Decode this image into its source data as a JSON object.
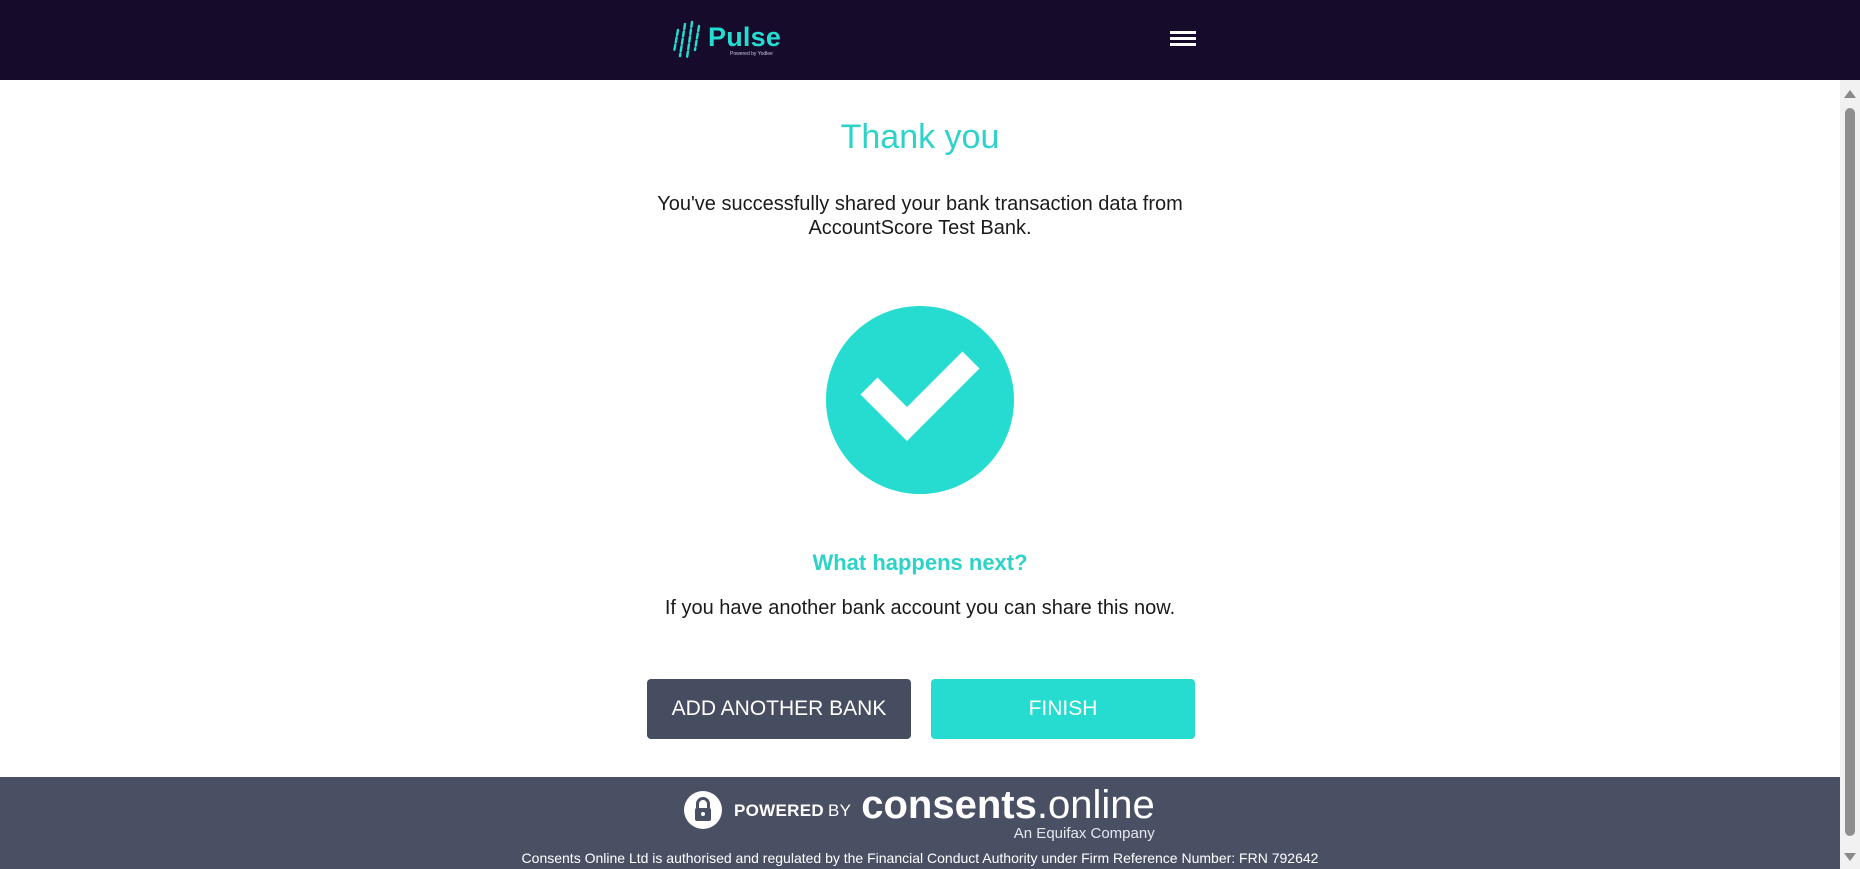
{
  "header": {
    "logo_word": "Pulse",
    "logo_sub": "Powered by Yodlee",
    "menu_icon": "hamburger-menu-icon"
  },
  "main": {
    "title": "Thank you",
    "message_line1": "You've successfully shared your bank transaction data from",
    "message_line2": "AccountScore Test Bank.",
    "status_icon": "check-circle-icon",
    "next_heading": "What happens next?",
    "next_text": "If you have another bank account you can share this now.",
    "add_bank_label": "ADD ANOTHER BANK",
    "finish_label": "FINISH"
  },
  "footer": {
    "powered": "POWERED",
    "by": "BY",
    "brand_bold": "consents",
    "brand_rest": ".online",
    "brand_sub": "An Equifax Company",
    "legal": "Consents Online Ltd is authorised and regulated by the Financial Conduct Authority under Firm Reference Number: FRN 792642"
  },
  "colors": {
    "header_bg": "#160b2b",
    "accent": "#26dcd0",
    "secondary_button": "#474d61",
    "footer_bg": "#4a5064"
  }
}
